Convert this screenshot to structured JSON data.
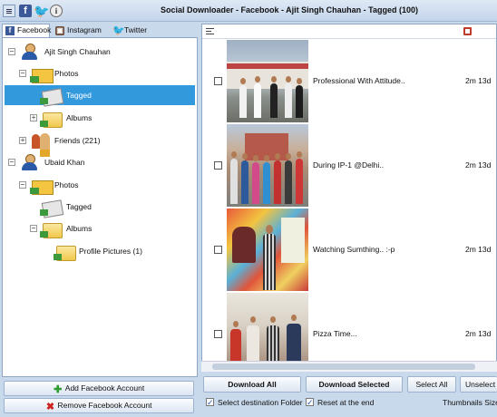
{
  "window": {
    "title": "Social Downloader - Facebook - Ajit Singh Chauhan - Tagged (100)"
  },
  "toolbar": {
    "info_glyph": "i"
  },
  "tabs": [
    {
      "label": "Facebook",
      "glyph": "f"
    },
    {
      "label": "Instagram",
      "glyph": "▣"
    },
    {
      "label": "Twitter",
      "glyph": "🐦"
    }
  ],
  "tree": {
    "accounts": [
      {
        "name": "Ajit Singh Chauhan",
        "photos_label": "Photos",
        "tagged_label": "Tagged",
        "albums_label": "Albums",
        "friends_label": "Friends (221)"
      },
      {
        "name": "Ubaid Khan",
        "photos_label": "Photos",
        "tagged_label": "Tagged",
        "albums_label": "Albums",
        "album_children": [
          "Profile Pictures (1)"
        ]
      }
    ],
    "expander": {
      "open": "−",
      "closed": "+"
    },
    "selected": "Tagged"
  },
  "account_buttons": {
    "add": "Add Facebook Account",
    "remove": "Remove Facebook Account",
    "add_glyph": "✚",
    "remove_glyph": "✖"
  },
  "photos": [
    {
      "caption": "Professional With Attitude..",
      "age": "2m 13d",
      "checked": false
    },
    {
      "caption": "During IP-1 @Delhi..",
      "age": "2m 13d",
      "checked": false
    },
    {
      "caption": "Watching Sumthing.. :-p",
      "age": "2m 13d",
      "checked": false
    },
    {
      "caption": "Pizza Time...",
      "age": "2m 13d",
      "checked": false
    }
  ],
  "actions": {
    "download_all": "Download All",
    "download_selected": "Download Selected",
    "select_all": "Select All",
    "unselect_all": "Unselect A"
  },
  "options": {
    "select_destination": "Select destination Folder",
    "reset_at_end": "Reset at the end",
    "thumbnails_size": "Thumbnails Size",
    "select_destination_checked": true,
    "reset_at_end_checked": true
  },
  "colors": {
    "selection": "#3399dd",
    "facebook": "#3b5998",
    "twitter": "#2aa9e0"
  }
}
